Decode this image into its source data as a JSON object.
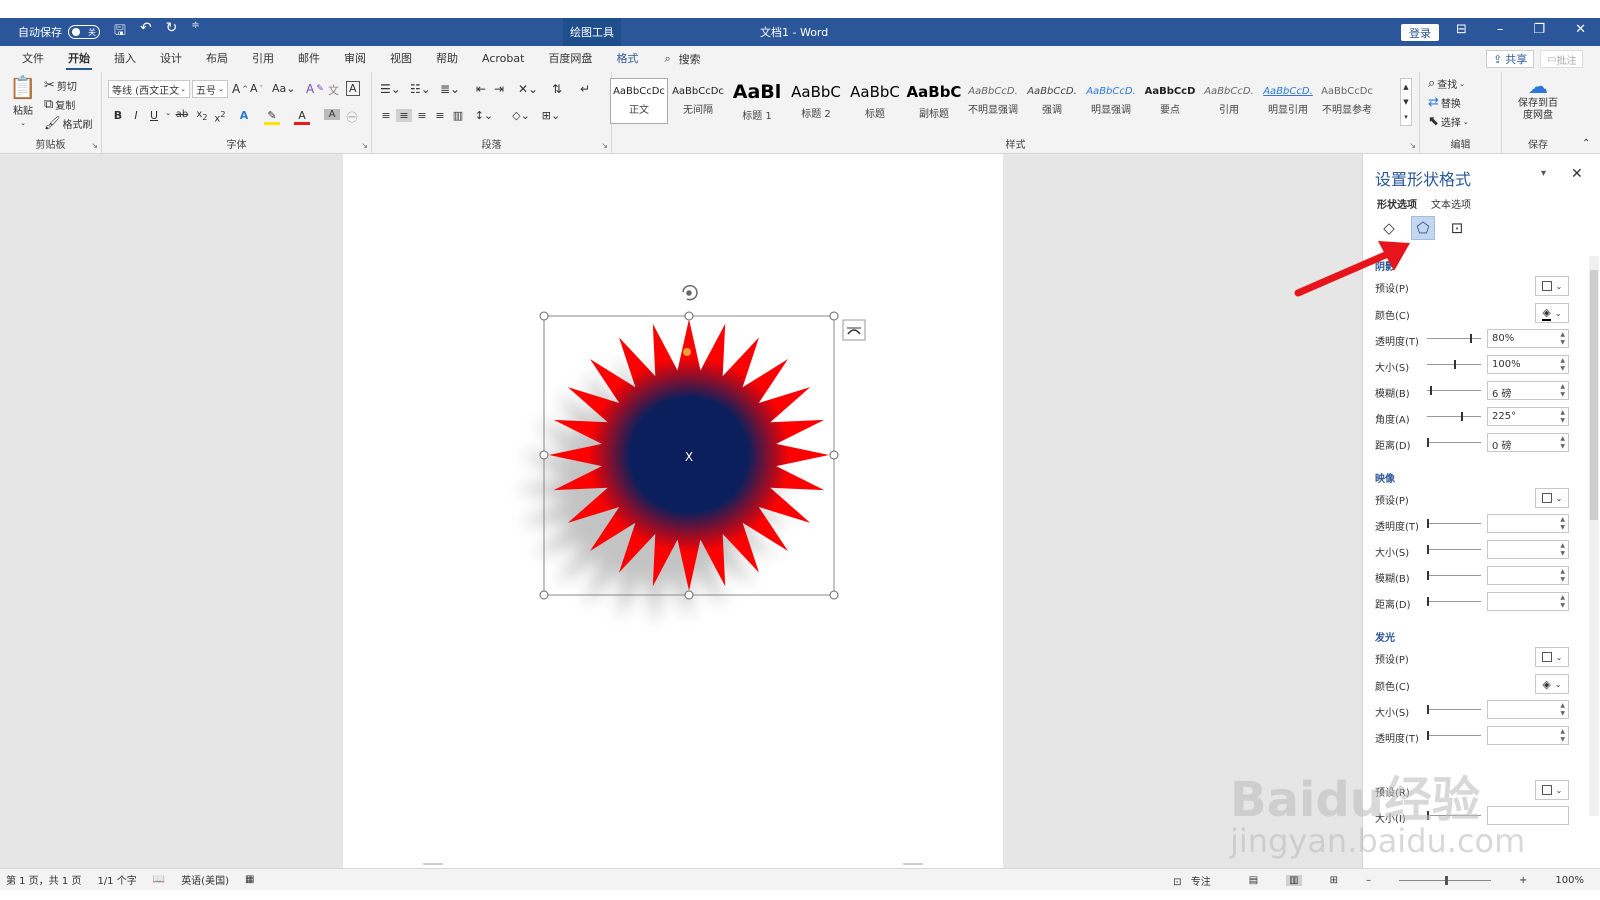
{
  "titlebar": {
    "autosave_label": "自动保存",
    "autosave_state": "关",
    "drawing_tools": "绘图工具",
    "doc_title": "文档1 - Word",
    "login": "登录"
  },
  "menu": {
    "tabs": [
      "文件",
      "开始",
      "插入",
      "设计",
      "布局",
      "引用",
      "邮件",
      "审阅",
      "视图",
      "帮助",
      "Acrobat",
      "百度网盘",
      "格式"
    ],
    "search": "搜索",
    "share": "共享",
    "comment": "批注"
  },
  "ribbon": {
    "clipboard": {
      "paste": "粘贴",
      "cut": "剪切",
      "copy": "复制",
      "format_painter": "格式刷",
      "label": "剪贴板"
    },
    "font": {
      "name": "等线 (西文正文",
      "size": "五号",
      "label": "字体"
    },
    "paragraph": {
      "label": "段落"
    },
    "styles": {
      "label": "样式",
      "items": [
        {
          "sample": "AaBbCcDc",
          "name": "正文"
        },
        {
          "sample": "AaBbCcDc",
          "name": "无间隔"
        },
        {
          "sample": "AaBl",
          "name": "标题 1"
        },
        {
          "sample": "AaBbC",
          "name": "标题 2"
        },
        {
          "sample": "AaBbC",
          "name": "标题"
        },
        {
          "sample": "AaBbC",
          "name": "副标题"
        },
        {
          "sample": "AaBbCcD.",
          "name": "不明显强调"
        },
        {
          "sample": "AaBbCcD.",
          "name": "强调"
        },
        {
          "sample": "AaBbCcD.",
          "name": "明显强调"
        },
        {
          "sample": "AaBbCcD",
          "name": "要点"
        },
        {
          "sample": "AaBbCcD.",
          "name": "引用"
        },
        {
          "sample": "AaBbCcD.",
          "name": "明显引用"
        },
        {
          "sample": "AaBbCcDc",
          "name": "不明显参考"
        }
      ]
    },
    "editing": {
      "find": "查找",
      "replace": "替换",
      "select": "选择",
      "label": "编辑"
    },
    "save": {
      "button": "保存到百度网盘",
      "label": "保存"
    }
  },
  "document": {
    "shape_text": "X"
  },
  "pane": {
    "title": "设置形状格式",
    "tab_shape": "形状选项",
    "tab_text": "文本选项",
    "shadow": {
      "heading": "阴影",
      "preset": "预设(P)",
      "color": "颜色(C)",
      "transparency": "透明度(T)",
      "transparency_value": "80%",
      "size": "大小(S)",
      "size_value": "100%",
      "blur": "模糊(B)",
      "blur_value": "6 磅",
      "angle": "角度(A)",
      "angle_value": "225°",
      "distance": "距离(D)",
      "distance_value": "0 磅"
    },
    "reflection": {
      "heading": "映像",
      "preset": "预设(P)",
      "transparency": "透明度(T)",
      "size": "大小(S)",
      "blur": "模糊(B)",
      "distance": "距离(D)"
    },
    "glow": {
      "heading": "发光",
      "preset": "预设(P)",
      "color": "颜色(C)",
      "size": "大小(S)",
      "transparency": "透明度(T)"
    },
    "soft_edges": {
      "preset": "预设(R)",
      "size": "大小(I)"
    }
  },
  "status": {
    "page": "第 1 页，共 1 页",
    "words": "1/1 个字",
    "language": "英语(美国)",
    "focus": "专注",
    "zoom": "100%"
  },
  "watermark": {
    "main": "Baidu经验",
    "url": "jingyan.baidu.com"
  },
  "colors": {
    "accent": "#2b579a",
    "star_outer": "#ff0000",
    "star_inner": "#0a1f5c",
    "arrow": "#e8141b"
  }
}
